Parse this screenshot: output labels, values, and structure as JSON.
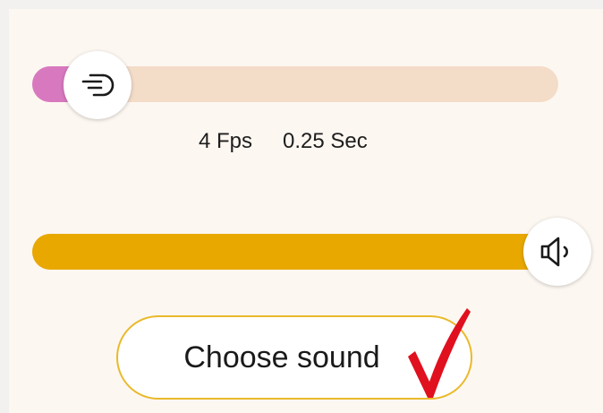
{
  "speed_slider": {
    "value_fraction": 0.08,
    "fill_color": "#d879bf",
    "track_color": "#f3dcc8",
    "icon": "speed-icon",
    "fps_label": "4 Fps",
    "seconds_label": "0.25 Sec"
  },
  "volume_slider": {
    "value_fraction": 1.0,
    "fill_color": "#e8a800",
    "icon": "speaker-icon"
  },
  "choose_sound": {
    "label": "Choose sound",
    "border_color": "#e9b92a"
  },
  "checkmark": {
    "icon": "checkmark-icon",
    "color": "#e0101e"
  }
}
